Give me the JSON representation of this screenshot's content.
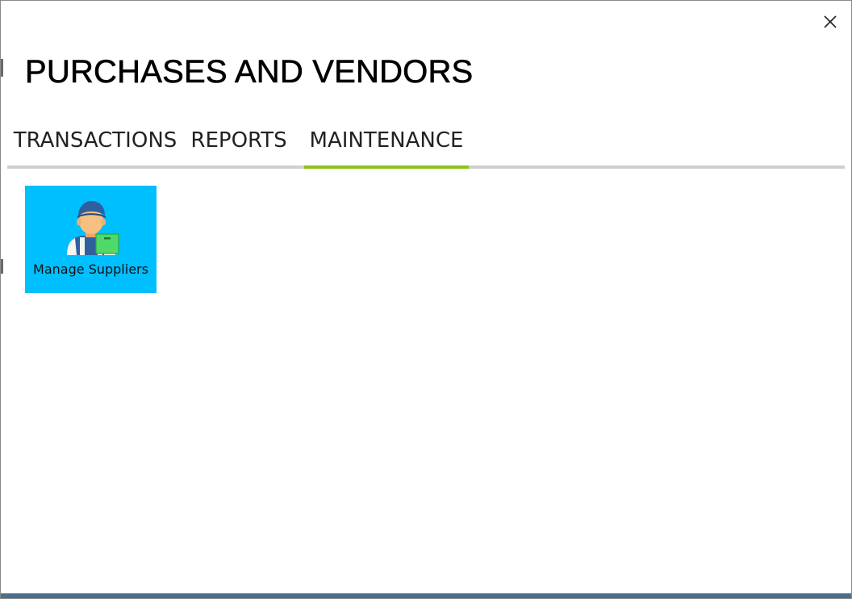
{
  "window": {
    "title": "PURCHASES AND VENDORS",
    "close_icon": "close-icon"
  },
  "tabs": [
    {
      "label": "TRANSACTIONS",
      "active": false
    },
    {
      "label": "REPORTS",
      "active": false
    },
    {
      "label": "MAINTENANCE",
      "active": true
    }
  ],
  "tiles": [
    {
      "label": "Manage Suppliers",
      "icon": "supplier-icon",
      "background": "#00bfff"
    }
  ],
  "colors": {
    "active_tab_underline": "#8cc21a",
    "tabbar_line": "#cfcfcf",
    "tile_background": "#00bfff",
    "bottom_bar": "#4a6e8c"
  }
}
